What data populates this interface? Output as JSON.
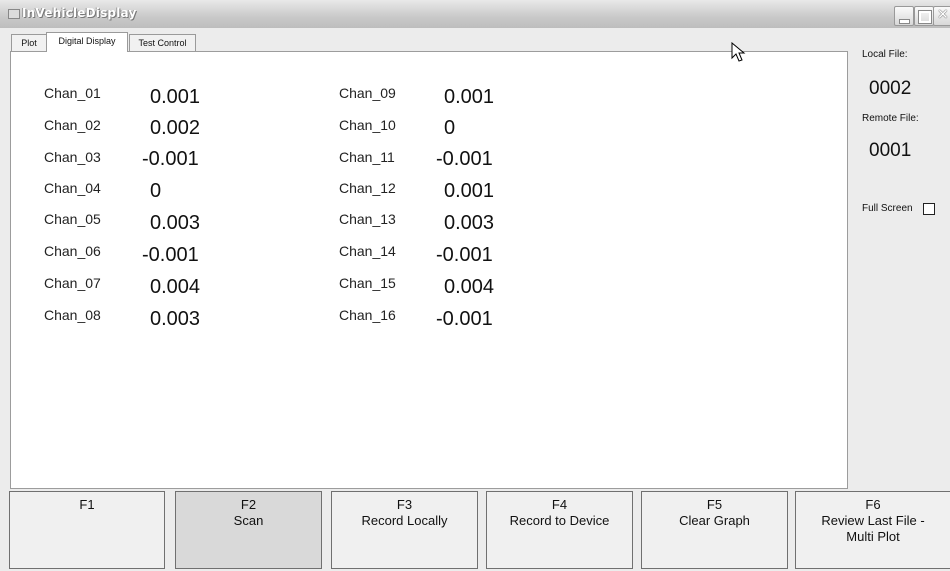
{
  "window": {
    "title": "InVehicleDisplay"
  },
  "tabs": [
    {
      "label": "Plot"
    },
    {
      "label": "Digital Display"
    },
    {
      "label": "Test Control"
    }
  ],
  "channels": [
    {
      "label": "Chan_01",
      "value": "0.001"
    },
    {
      "label": "Chan_02",
      "value": "0.002"
    },
    {
      "label": "Chan_03",
      "value": "-0.001"
    },
    {
      "label": "Chan_04",
      "value": "0"
    },
    {
      "label": "Chan_05",
      "value": "0.003"
    },
    {
      "label": "Chan_06",
      "value": "-0.001"
    },
    {
      "label": "Chan_07",
      "value": "0.004"
    },
    {
      "label": "Chan_08",
      "value": "0.003"
    },
    {
      "label": "Chan_09",
      "value": "0.001"
    },
    {
      "label": "Chan_10",
      "value": "0"
    },
    {
      "label": "Chan_11",
      "value": "-0.001"
    },
    {
      "label": "Chan_12",
      "value": "0.001"
    },
    {
      "label": "Chan_13",
      "value": "0.003"
    },
    {
      "label": "Chan_14",
      "value": "-0.001"
    },
    {
      "label": "Chan_15",
      "value": "0.004"
    },
    {
      "label": "Chan_16",
      "value": "-0.001"
    }
  ],
  "side": {
    "local_file_label": "Local File:",
    "local_file_value": "0002",
    "remote_file_label": "Remote File:",
    "remote_file_value": "0001",
    "full_screen_label": "Full Screen",
    "full_screen_checked": false
  },
  "fkeys": [
    {
      "key": "F1",
      "label": ""
    },
    {
      "key": "F2",
      "label": "Scan"
    },
    {
      "key": "F3",
      "label": "Record Locally"
    },
    {
      "key": "F4",
      "label": "Record to Device"
    },
    {
      "key": "F5",
      "label": "Clear Graph"
    },
    {
      "key": "F6",
      "label": "Review Last File -",
      "label2": "Multi Plot"
    }
  ]
}
